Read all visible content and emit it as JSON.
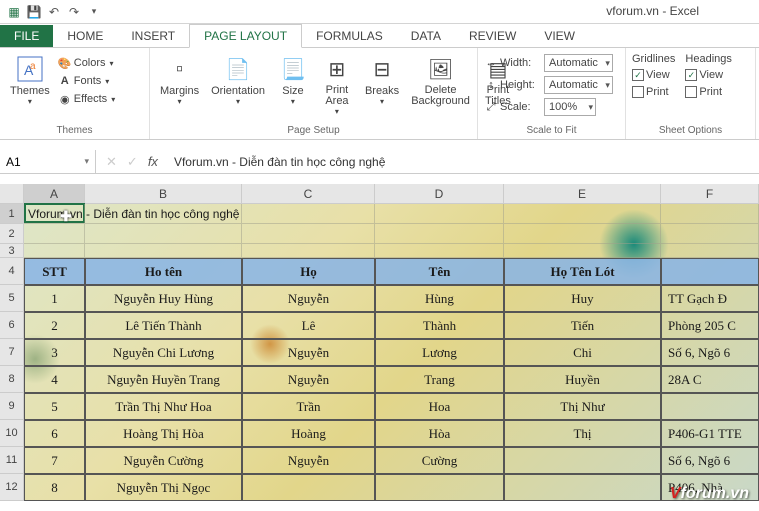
{
  "app": {
    "title": "vforum.vn - Excel"
  },
  "qat": {
    "save": "save",
    "undo": "undo",
    "redo": "redo"
  },
  "tabs": {
    "file": "FILE",
    "home": "HOME",
    "insert": "INSERT",
    "pagelayout": "PAGE LAYOUT",
    "formulas": "FORMULAS",
    "data": "DATA",
    "review": "REVIEW",
    "view": "VIEW"
  },
  "ribbon": {
    "themes": {
      "label": "Themes",
      "themes_btn": "Themes",
      "colors": "Colors",
      "fonts": "Fonts",
      "effects": "Effects"
    },
    "page_setup": {
      "label": "Page Setup",
      "margins": "Margins",
      "orientation": "Orientation",
      "size": "Size",
      "print_area": "Print\nArea",
      "breaks": "Breaks",
      "background": "Delete\nBackground",
      "titles": "Print\nTitles"
    },
    "scale": {
      "label": "Scale to Fit",
      "width": "Width:",
      "height": "Height:",
      "scale": "Scale:",
      "width_val": "Automatic",
      "height_val": "Automatic",
      "scale_val": "100%"
    },
    "sheet_options": {
      "label": "Sheet Options",
      "gridlines": "Gridlines",
      "headings": "Headings",
      "view": "View",
      "print": "Print"
    }
  },
  "namebox": "A1",
  "formula": "Vforum.vn - Diễn đàn tin học công nghệ",
  "columns": [
    "A",
    "B",
    "C",
    "D",
    "E",
    "F"
  ],
  "row1_text": "Vforum.vn - Diễn đàn tin học công nghệ",
  "headers": {
    "stt": "STT",
    "hoten": "Ho tên",
    "ho": "Họ",
    "ten": "Tên",
    "hotenlot": "Họ Tên Lót",
    "f": ""
  },
  "chart_data": {
    "type": "table",
    "title": "Vforum.vn - Diễn đàn tin học công nghệ",
    "columns": [
      "STT",
      "Ho tên",
      "Họ",
      "Tên",
      "Họ Tên Lót",
      ""
    ],
    "rows": [
      [
        "1",
        "Nguyễn Huy Hùng",
        "Nguyễn",
        "Hùng",
        "Huy",
        "TT Gạch Đ"
      ],
      [
        "2",
        "Lê Tiến Thành",
        "Lê",
        "Thành",
        "Tiến",
        "Phòng 205 C"
      ],
      [
        "3",
        "Nguyễn Chi Lương",
        "Nguyễn",
        "Lương",
        "Chi",
        "Số 6, Ngõ 6"
      ],
      [
        "4",
        "Nguyễn Huyền Trang",
        "Nguyễn",
        "Trang",
        "Huyền",
        "28A C"
      ],
      [
        "5",
        "Trần Thị Như Hoa",
        "Trần",
        "Hoa",
        "Thị Như",
        ""
      ],
      [
        "6",
        "Hoàng Thị Hòa",
        "Hoàng",
        "Hòa",
        "Thị",
        "P406-G1 TTE"
      ],
      [
        "7",
        "Nguyễn  Cường",
        "Nguyễn",
        "Cường",
        "",
        "Số 6, Ngõ 6"
      ],
      [
        "8",
        "Nguyễn Thị Ngọc",
        "",
        "",
        "",
        "P406, Nhà"
      ]
    ]
  },
  "watermark": {
    "v": "V",
    "rest": "forum.vn"
  }
}
